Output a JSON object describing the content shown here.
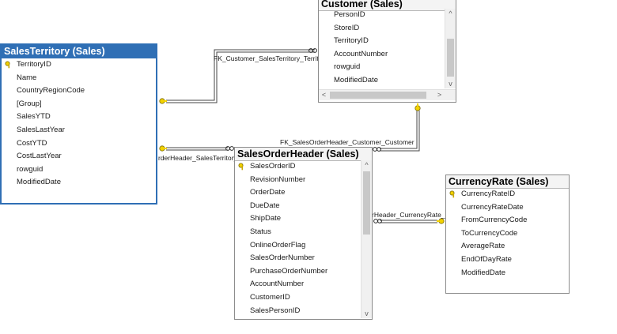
{
  "tables": {
    "sales_territory": {
      "title": "SalesTerritory (Sales)",
      "columns": [
        "TerritoryID",
        "Name",
        "CountryRegionCode",
        "[Group]",
        "SalesYTD",
        "SalesLastYear",
        "CostYTD",
        "CostLastYear",
        "rowguid",
        "ModifiedDate"
      ],
      "key_column": "TerritoryID"
    },
    "customer": {
      "title": "Customer (Sales)",
      "columns": [
        "PersonID",
        "StoreID",
        "TerritoryID",
        "AccountNumber",
        "rowguid",
        "ModifiedDate"
      ]
    },
    "sales_order_header": {
      "title": "SalesOrderHeader (Sales)",
      "columns": [
        "SalesOrderID",
        "RevisionNumber",
        "OrderDate",
        "DueDate",
        "ShipDate",
        "Status",
        "OnlineOrderFlag",
        "SalesOrderNumber",
        "PurchaseOrderNumber",
        "AccountNumber",
        "CustomerID",
        "SalesPersonID"
      ],
      "key_column": "SalesOrderID"
    },
    "currency_rate": {
      "title": "CurrencyRate (Sales)",
      "columns": [
        "CurrencyRateID",
        "CurrencyRateDate",
        "FromCurrencyCode",
        "ToCurrencyCode",
        "AverageRate",
        "EndOfDayRate",
        "ModifiedDate"
      ],
      "key_column": "CurrencyRateID"
    }
  },
  "relationships": {
    "customer_territory": "FK_Customer_SalesTerritory_Territor",
    "order_customer": "FK_SalesOrderHeader_Customer_CustomerID",
    "order_territory": "rderHeader_SalesTerritory_",
    "order_currency": "rHeader_CurrencyRate_C"
  },
  "scrollbar_glyphs": {
    "up": "^",
    "down": "v",
    "left": "<",
    "right": ">"
  },
  "colors": {
    "selected_border": "#2f6fb5",
    "connector": "#444444",
    "key_icon": "#f2d100"
  },
  "icons": {
    "key": "key-icon",
    "infinity": "infinity-icon"
  }
}
